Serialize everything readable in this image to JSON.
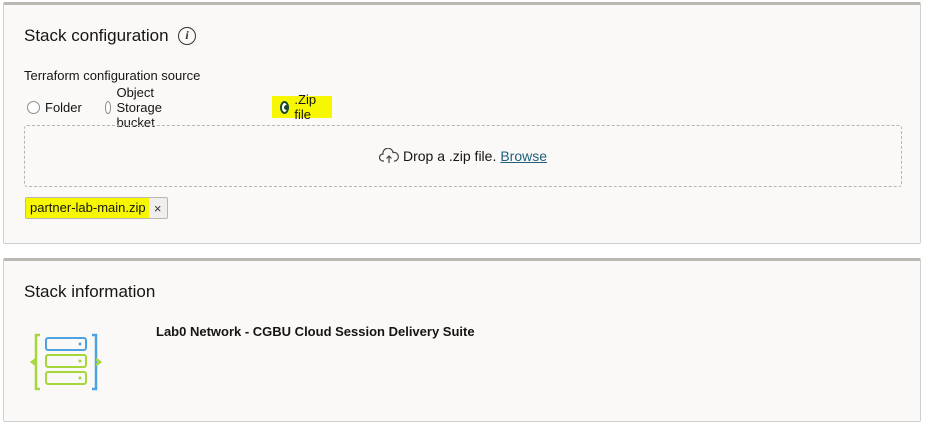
{
  "config_panel": {
    "title": "Stack configuration",
    "info_icon": "info-icon",
    "source_label": "Terraform configuration source",
    "radios": [
      {
        "label": "Folder",
        "selected": false
      },
      {
        "label": "Object Storage bucket",
        "selected": false
      },
      {
        "label": ".Zip file",
        "selected": true
      }
    ],
    "drop_zone": {
      "icon": "cloud-upload-icon",
      "text": "Drop a .zip file.",
      "browse_label": "Browse"
    },
    "file_chip": {
      "name": "partner-lab-main.zip",
      "remove_label": "×"
    }
  },
  "info_panel": {
    "title": "Stack information",
    "stack_icon": "stack-server-icon",
    "stack_name": "Lab0 Network - CGBU Cloud Session Delivery Suite"
  },
  "colors": {
    "highlight": "#f6f700",
    "link": "#1f5f7a",
    "radio_selected": "#1b4a2a",
    "graphic_blue": "#4da3e0",
    "graphic_green": "#a6d63a"
  }
}
